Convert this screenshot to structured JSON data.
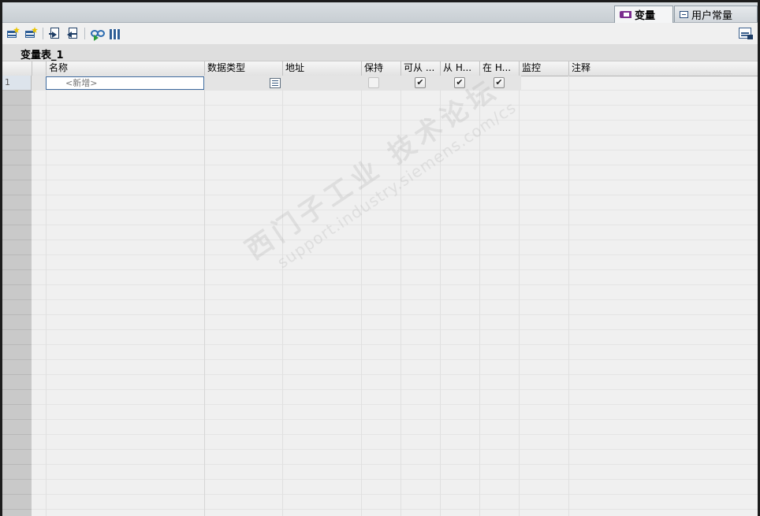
{
  "tabs": [
    {
      "label": "变量",
      "icon": "tag-icon",
      "active": true
    },
    {
      "label": "用户常量",
      "icon": "constant-icon",
      "active": false
    }
  ],
  "toolbar": {
    "buttons": [
      {
        "name": "add-row-button",
        "icon": "add-row-icon"
      },
      {
        "name": "insert-row-button",
        "icon": "insert-row-icon"
      },
      {
        "name": "export-button",
        "icon": "export-icon"
      },
      {
        "name": "import-button",
        "icon": "import-icon"
      },
      {
        "name": "monitor-all-button",
        "icon": "glasses-icon"
      },
      {
        "name": "columns-button",
        "icon": "columns-icon"
      }
    ],
    "right_icon": "view-settings-icon"
  },
  "table": {
    "title": "变量表_1",
    "columns": [
      "名称",
      "数据类型",
      "地址",
      "保持",
      "可从 ...",
      "从 H...",
      "在 H...",
      "监控",
      "注释"
    ],
    "rows": [
      {
        "num": "1",
        "name_placeholder": "<新增>",
        "data_type": "",
        "address": "",
        "retain": false,
        "accessible_from_hmi": true,
        "visible_in_hmi": true,
        "hmi_setpoint": true,
        "monitor": "",
        "comment": ""
      }
    ]
  },
  "watermark": {
    "line1": "西门子工业 技术论坛",
    "line2": "support.industry.siemens.com/cs"
  },
  "colors": {
    "tab_icon": "#7b2d8e",
    "selection_border": "#3d6a9e",
    "row_header": "#c9c9c9"
  }
}
